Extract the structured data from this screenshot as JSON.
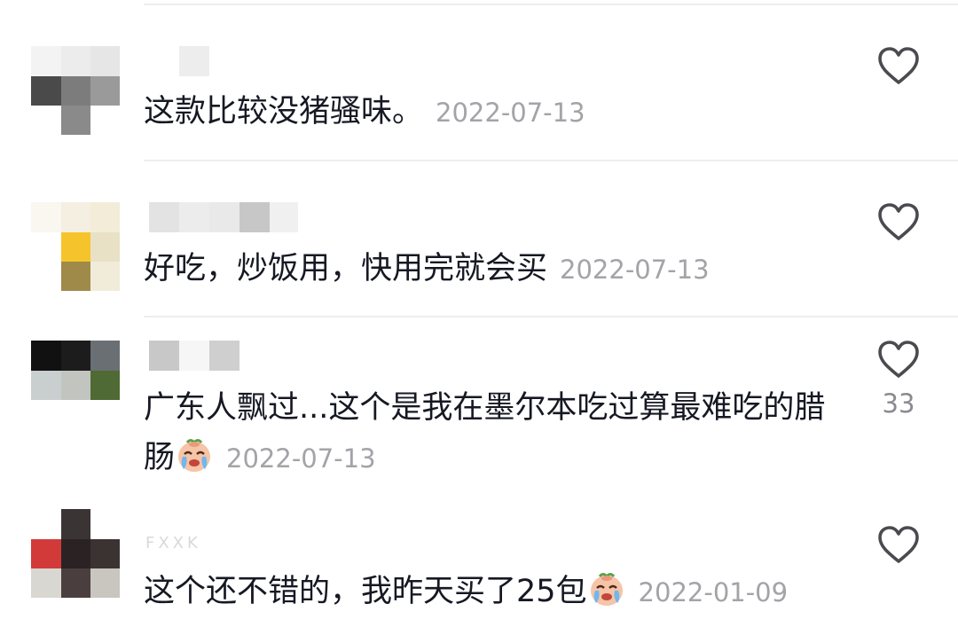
{
  "comments": [
    {
      "text": "这款比较没猪骚味。",
      "date": "2022-07-13",
      "likes": "",
      "liked": false
    },
    {
      "text": "好吃，炒饭用，快用完就会买",
      "date": "2022-07-13",
      "likes": "",
      "liked": false
    },
    {
      "text": "广东人飘过...这个是我在墨尔本吃过算最难吃的腊肠",
      "date": "2022-07-13",
      "likes": "33",
      "liked": false,
      "emoji": "crying-face-emoji"
    },
    {
      "text": "这个还不错的，我昨天买了25包",
      "date": "2022-01-09",
      "likes": "",
      "liked": false,
      "emoji": "crying-face-emoji",
      "username_partial": "FXXK"
    }
  ],
  "icons": {
    "like": "heart-outline-icon"
  },
  "colors": {
    "text": "#161823",
    "date": "#a3a3a8",
    "heart": "#4a4a4f",
    "divider": "#eeeeee"
  }
}
